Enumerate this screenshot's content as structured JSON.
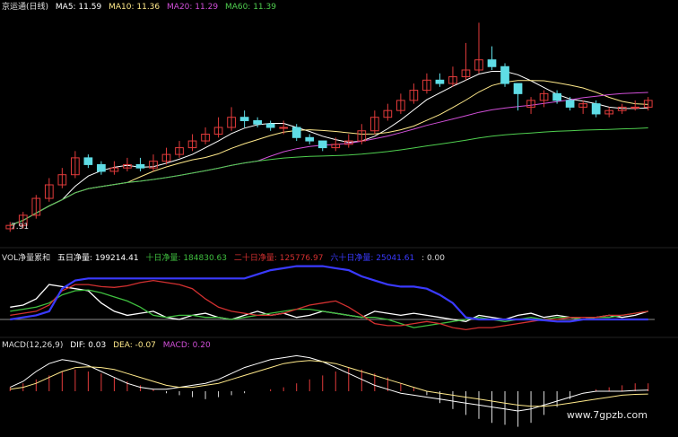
{
  "price_panel": {
    "title": "京运通(日线)",
    "ma": [
      {
        "label": "MA5: 11.59",
        "color": "#ffffff"
      },
      {
        "label": "MA10: 11.36",
        "color": "#ffe98a"
      },
      {
        "label": "MA20: 11.29",
        "color": "#d14fd8"
      },
      {
        "label": "MA60: 11.39",
        "color": "#4fcf4f"
      }
    ],
    "low_marker": "7.91"
  },
  "vol_panel": {
    "items": [
      {
        "label": "VOL净量累和",
        "color": "#dddddd"
      },
      {
        "label": "五日净量: 199214.41",
        "color": "#ffffff"
      },
      {
        "label": "十日净量: 184830.63",
        "color": "#3fbf3f"
      },
      {
        "label": "二十日净量: 125776.97",
        "color": "#d23030"
      },
      {
        "label": "六十日净量: 25041.61",
        "color": "#3a3aff"
      },
      {
        "label": ": 0.00",
        "color": "#dddddd"
      }
    ]
  },
  "macd_panel": {
    "items": [
      {
        "label": "MACD(12,26,9)",
        "color": "#dddddd"
      },
      {
        "label": "DIF: 0.03",
        "color": "#ffffff"
      },
      {
        "label": "DEA: -0.07",
        "color": "#ffe98a"
      },
      {
        "label": "MACD: 0.20",
        "color": "#d14fd8"
      }
    ]
  },
  "watermark": "www.7gpzb.com",
  "chart_data": [
    {
      "type": "candlestick",
      "x": [
        1,
        2,
        3,
        4,
        5,
        6,
        7,
        8,
        9,
        10,
        11,
        12,
        13,
        14,
        15,
        16,
        17,
        18,
        19,
        20,
        21,
        22,
        23,
        24,
        25,
        26,
        27,
        28,
        29,
        30,
        31,
        32,
        33,
        34,
        35,
        36,
        37,
        38,
        39,
        40,
        41,
        42,
        43,
        44,
        45,
        46,
        47,
        48,
        49,
        50
      ],
      "open": [
        8.0,
        8.1,
        8.4,
        8.9,
        9.3,
        9.6,
        10.1,
        9.9,
        9.7,
        9.8,
        9.9,
        9.8,
        10.0,
        10.2,
        10.4,
        10.6,
        10.8,
        11.0,
        11.3,
        11.2,
        11.1,
        11.0,
        11.0,
        10.7,
        10.6,
        10.4,
        10.5,
        10.6,
        10.9,
        11.3,
        11.5,
        11.8,
        12.1,
        12.4,
        12.3,
        12.5,
        12.7,
        13.0,
        12.8,
        12.3,
        11.6,
        11.8,
        12.0,
        11.8,
        11.6,
        11.7,
        11.4,
        11.5,
        11.6,
        11.6
      ],
      "close": [
        8.1,
        8.4,
        8.9,
        9.3,
        9.6,
        10.1,
        9.9,
        9.7,
        9.8,
        9.9,
        9.8,
        10.0,
        10.2,
        10.4,
        10.6,
        10.8,
        11.0,
        11.3,
        11.2,
        11.1,
        11.0,
        11.0,
        10.7,
        10.6,
        10.4,
        10.5,
        10.6,
        10.9,
        11.3,
        11.5,
        11.8,
        12.1,
        12.4,
        12.3,
        12.5,
        12.7,
        13.0,
        12.8,
        12.3,
        12.0,
        11.8,
        12.0,
        11.8,
        11.6,
        11.7,
        11.4,
        11.5,
        11.6,
        11.6,
        11.8
      ],
      "high": [
        8.2,
        8.5,
        9.0,
        9.5,
        9.8,
        10.3,
        10.2,
        10.0,
        10.0,
        10.1,
        10.1,
        10.2,
        10.4,
        10.6,
        10.8,
        11.0,
        11.3,
        11.6,
        11.5,
        11.3,
        11.2,
        11.2,
        11.1,
        10.8,
        10.6,
        10.7,
        10.8,
        11.1,
        11.5,
        11.7,
        12.0,
        12.3,
        12.6,
        12.6,
        12.8,
        13.5,
        14.1,
        13.4,
        12.9,
        12.1,
        11.9,
        12.1,
        12.1,
        11.9,
        11.8,
        11.8,
        11.6,
        11.7,
        11.8,
        11.9
      ],
      "low": [
        7.91,
        8.0,
        8.3,
        8.8,
        9.2,
        9.5,
        9.8,
        9.6,
        9.6,
        9.7,
        9.7,
        9.7,
        9.9,
        10.1,
        10.3,
        10.5,
        10.7,
        10.9,
        11.0,
        11.0,
        10.9,
        10.8,
        10.6,
        10.5,
        10.3,
        10.3,
        10.4,
        10.5,
        10.8,
        11.2,
        11.4,
        11.7,
        12.0,
        12.2,
        12.2,
        12.4,
        12.6,
        12.7,
        12.2,
        11.5,
        11.4,
        11.6,
        11.7,
        11.5,
        11.4,
        11.3,
        11.3,
        11.4,
        11.5,
        11.5
      ],
      "ylim": [
        7.6,
        14.4
      ]
    },
    {
      "type": "line",
      "x": [
        1,
        2,
        3,
        4,
        5,
        6,
        7,
        8,
        9,
        10,
        11,
        12,
        13,
        14,
        15,
        16,
        17,
        18,
        19,
        20,
        21,
        22,
        23,
        24,
        25,
        26,
        27,
        28,
        29,
        30,
        31,
        32,
        33,
        34,
        35,
        36,
        37,
        38,
        39,
        40,
        41,
        42,
        43,
        44,
        45,
        46,
        47,
        48,
        49,
        50
      ],
      "series": [
        {
          "name": "五日净量",
          "values": [
            0.3,
            0.35,
            0.5,
            0.85,
            0.8,
            0.75,
            0.7,
            0.4,
            0.2,
            0.1,
            0.15,
            0.2,
            0.05,
            0.0,
            0.1,
            0.15,
            0.05,
            0.0,
            0.1,
            0.2,
            0.1,
            0.15,
            0.05,
            0.1,
            0.2,
            0.15,
            0.1,
            0.05,
            0.2,
            0.15,
            0.1,
            0.15,
            0.1,
            0.05,
            0.0,
            -0.05,
            0.1,
            0.05,
            0.0,
            0.1,
            0.15,
            0.05,
            0.1,
            0.05,
            0.0,
            0.05,
            0.1,
            0.05,
            0.1,
            0.2
          ]
        },
        {
          "name": "十日净量",
          "values": [
            0.2,
            0.25,
            0.3,
            0.4,
            0.6,
            0.7,
            0.72,
            0.65,
            0.55,
            0.45,
            0.3,
            0.1,
            0.05,
            0.1,
            0.1,
            0.05,
            0.05,
            0.0,
            0.05,
            0.1,
            0.15,
            0.2,
            0.25,
            0.25,
            0.2,
            0.15,
            0.1,
            0.05,
            0.05,
            0.0,
            -0.1,
            -0.2,
            -0.15,
            -0.1,
            -0.05,
            0.0,
            0.05,
            0.0,
            -0.05,
            0.0,
            0.05,
            0.0,
            0.05,
            0.05,
            0.0,
            0.05,
            0.05,
            0.1,
            0.15,
            0.2
          ]
        },
        {
          "name": "二十日净量",
          "values": [
            0.1,
            0.15,
            0.2,
            0.35,
            0.7,
            0.85,
            0.85,
            0.8,
            0.78,
            0.82,
            0.9,
            0.95,
            0.9,
            0.85,
            0.75,
            0.5,
            0.3,
            0.2,
            0.15,
            0.1,
            0.1,
            0.15,
            0.25,
            0.35,
            0.4,
            0.45,
            0.3,
            0.1,
            -0.1,
            -0.15,
            -0.15,
            -0.1,
            -0.05,
            -0.1,
            -0.2,
            -0.25,
            -0.2,
            -0.2,
            -0.15,
            -0.1,
            -0.05,
            0.0,
            0.0,
            0.05,
            0.05,
            0.05,
            0.1,
            0.1,
            0.15,
            0.2
          ]
        },
        {
          "name": "六十日净量",
          "values": [
            0.0,
            0.05,
            0.1,
            0.2,
            0.75,
            0.95,
            1.0,
            1.0,
            1.0,
            1.0,
            1.0,
            1.0,
            1.0,
            1.0,
            1.0,
            1.0,
            1.0,
            1.0,
            1.0,
            1.1,
            1.2,
            1.25,
            1.3,
            1.3,
            1.3,
            1.25,
            1.2,
            1.05,
            0.95,
            0.85,
            0.8,
            0.8,
            0.75,
            0.6,
            0.4,
            0.05,
            0.0,
            0.0,
            0.0,
            0.0,
            0.0,
            -0.02,
            -0.05,
            -0.05,
            0.0,
            0.0,
            0.0,
            0.0,
            0.0,
            0.0
          ]
        }
      ],
      "ylim": [
        -0.35,
        1.4
      ]
    },
    {
      "type": "bar",
      "x": [
        1,
        2,
        3,
        4,
        5,
        6,
        7,
        8,
        9,
        10,
        11,
        12,
        13,
        14,
        15,
        16,
        17,
        18,
        19,
        20,
        21,
        22,
        23,
        24,
        25,
        26,
        27,
        28,
        29,
        30,
        31,
        32,
        33,
        34,
        35,
        36,
        37,
        38,
        39,
        40,
        41,
        42,
        43,
        44,
        45,
        46,
        47,
        48,
        49,
        50
      ],
      "values": [
        0.1,
        0.2,
        0.3,
        0.4,
        0.5,
        0.55,
        0.5,
        0.45,
        0.35,
        0.25,
        0.15,
        0.05,
        -0.05,
        -0.1,
        -0.15,
        -0.2,
        -0.15,
        -0.1,
        -0.05,
        0.0,
        0.05,
        0.1,
        0.2,
        0.3,
        0.4,
        0.5,
        0.6,
        0.55,
        0.45,
        0.35,
        0.2,
        0.1,
        -0.1,
        -0.3,
        -0.45,
        -0.6,
        -0.7,
        -0.8,
        -0.85,
        -0.9,
        -0.8,
        -0.6,
        -0.4,
        -0.2,
        0.0,
        0.05,
        0.1,
        0.15,
        0.2,
        0.2
      ],
      "series": [
        {
          "name": "DIF",
          "values": [
            0.1,
            0.25,
            0.5,
            0.7,
            0.8,
            0.75,
            0.65,
            0.5,
            0.35,
            0.2,
            0.1,
            0.05,
            0.05,
            0.1,
            0.15,
            0.2,
            0.3,
            0.45,
            0.6,
            0.7,
            0.8,
            0.85,
            0.9,
            0.85,
            0.75,
            0.6,
            0.45,
            0.3,
            0.15,
            0.05,
            -0.05,
            -0.1,
            -0.15,
            -0.2,
            -0.25,
            -0.3,
            -0.35,
            -0.4,
            -0.45,
            -0.5,
            -0.45,
            -0.35,
            -0.25,
            -0.15,
            -0.05,
            0.0,
            0.0,
            0.0,
            0.02,
            0.03
          ]
        },
        {
          "name": "DEA",
          "values": [
            0.05,
            0.1,
            0.2,
            0.35,
            0.5,
            0.6,
            0.62,
            0.6,
            0.55,
            0.45,
            0.35,
            0.25,
            0.15,
            0.1,
            0.1,
            0.15,
            0.2,
            0.3,
            0.4,
            0.5,
            0.6,
            0.7,
            0.75,
            0.78,
            0.75,
            0.7,
            0.6,
            0.5,
            0.4,
            0.3,
            0.2,
            0.1,
            0.0,
            -0.05,
            -0.1,
            -0.15,
            -0.2,
            -0.25,
            -0.3,
            -0.35,
            -0.38,
            -0.38,
            -0.35,
            -0.3,
            -0.25,
            -0.2,
            -0.15,
            -0.1,
            -0.08,
            -0.07
          ]
        }
      ],
      "ylim": [
        -1.0,
        1.0
      ]
    }
  ]
}
